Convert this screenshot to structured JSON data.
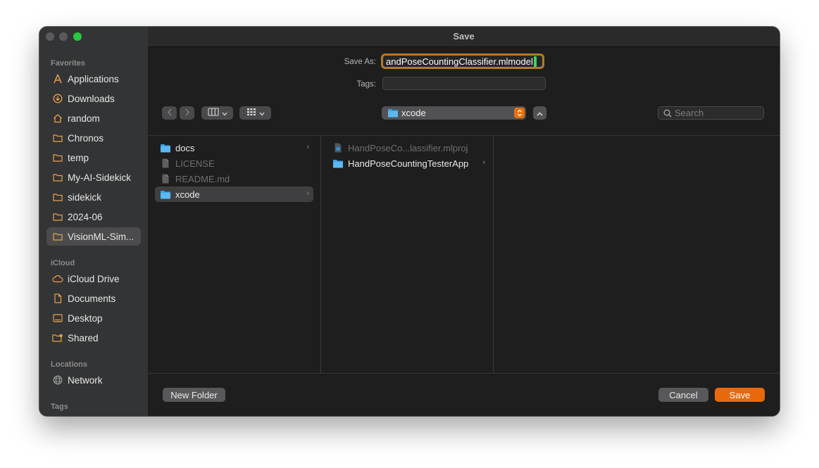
{
  "window": {
    "title": "Save"
  },
  "sidebar": {
    "favorites_heading": "Favorites",
    "favorites": [
      {
        "label": "Applications",
        "icon": "applications-icon"
      },
      {
        "label": "Downloads",
        "icon": "downloads-icon"
      },
      {
        "label": "random",
        "icon": "home-icon"
      },
      {
        "label": "Chronos",
        "icon": "folder-icon"
      },
      {
        "label": "temp",
        "icon": "folder-icon"
      },
      {
        "label": "My-AI-Sidekick",
        "icon": "folder-icon"
      },
      {
        "label": "sidekick",
        "icon": "folder-icon"
      },
      {
        "label": "2024-06",
        "icon": "folder-icon"
      },
      {
        "label": "VisionML-Sim...",
        "icon": "folder-icon",
        "selected": true
      }
    ],
    "icloud_heading": "iCloud",
    "icloud": [
      {
        "label": "iCloud Drive",
        "icon": "cloud-icon"
      },
      {
        "label": "Documents",
        "icon": "document-icon"
      },
      {
        "label": "Desktop",
        "icon": "desktop-icon"
      },
      {
        "label": "Shared",
        "icon": "shared-folder-icon"
      }
    ],
    "locations_heading": "Locations",
    "locations": [
      {
        "label": "Network",
        "icon": "globe-icon"
      }
    ],
    "tags_heading": "Tags"
  },
  "form": {
    "save_as_label": "Save As:",
    "save_as_value": "andPoseCountingClassifier.mlmodel",
    "tags_label": "Tags:"
  },
  "toolbar": {
    "path_folder": "xcode",
    "search_placeholder": "Search"
  },
  "columns": [
    [
      {
        "label": "docs",
        "icon": "folder-icon",
        "has_children": true
      },
      {
        "label": "LICENSE",
        "icon": "file-icon",
        "dimmed": true
      },
      {
        "label": "README.md",
        "icon": "file-icon",
        "dimmed": true
      },
      {
        "label": "xcode",
        "icon": "folder-icon",
        "has_children": true,
        "selected": true
      }
    ],
    [
      {
        "label": "HandPoseCo...lassifier.mlproj",
        "icon": "mlproj-icon",
        "dimmed": true
      },
      {
        "label": "HandPoseCountingTesterApp",
        "icon": "folder-icon",
        "has_children": true
      }
    ]
  ],
  "footer": {
    "new_folder_label": "New Folder",
    "cancel_label": "Cancel",
    "save_label": "Save"
  },
  "colors": {
    "accent": "#e8690c",
    "sidebar_icon": "#e8a04a",
    "folder_blue": "#3aa3e8"
  }
}
